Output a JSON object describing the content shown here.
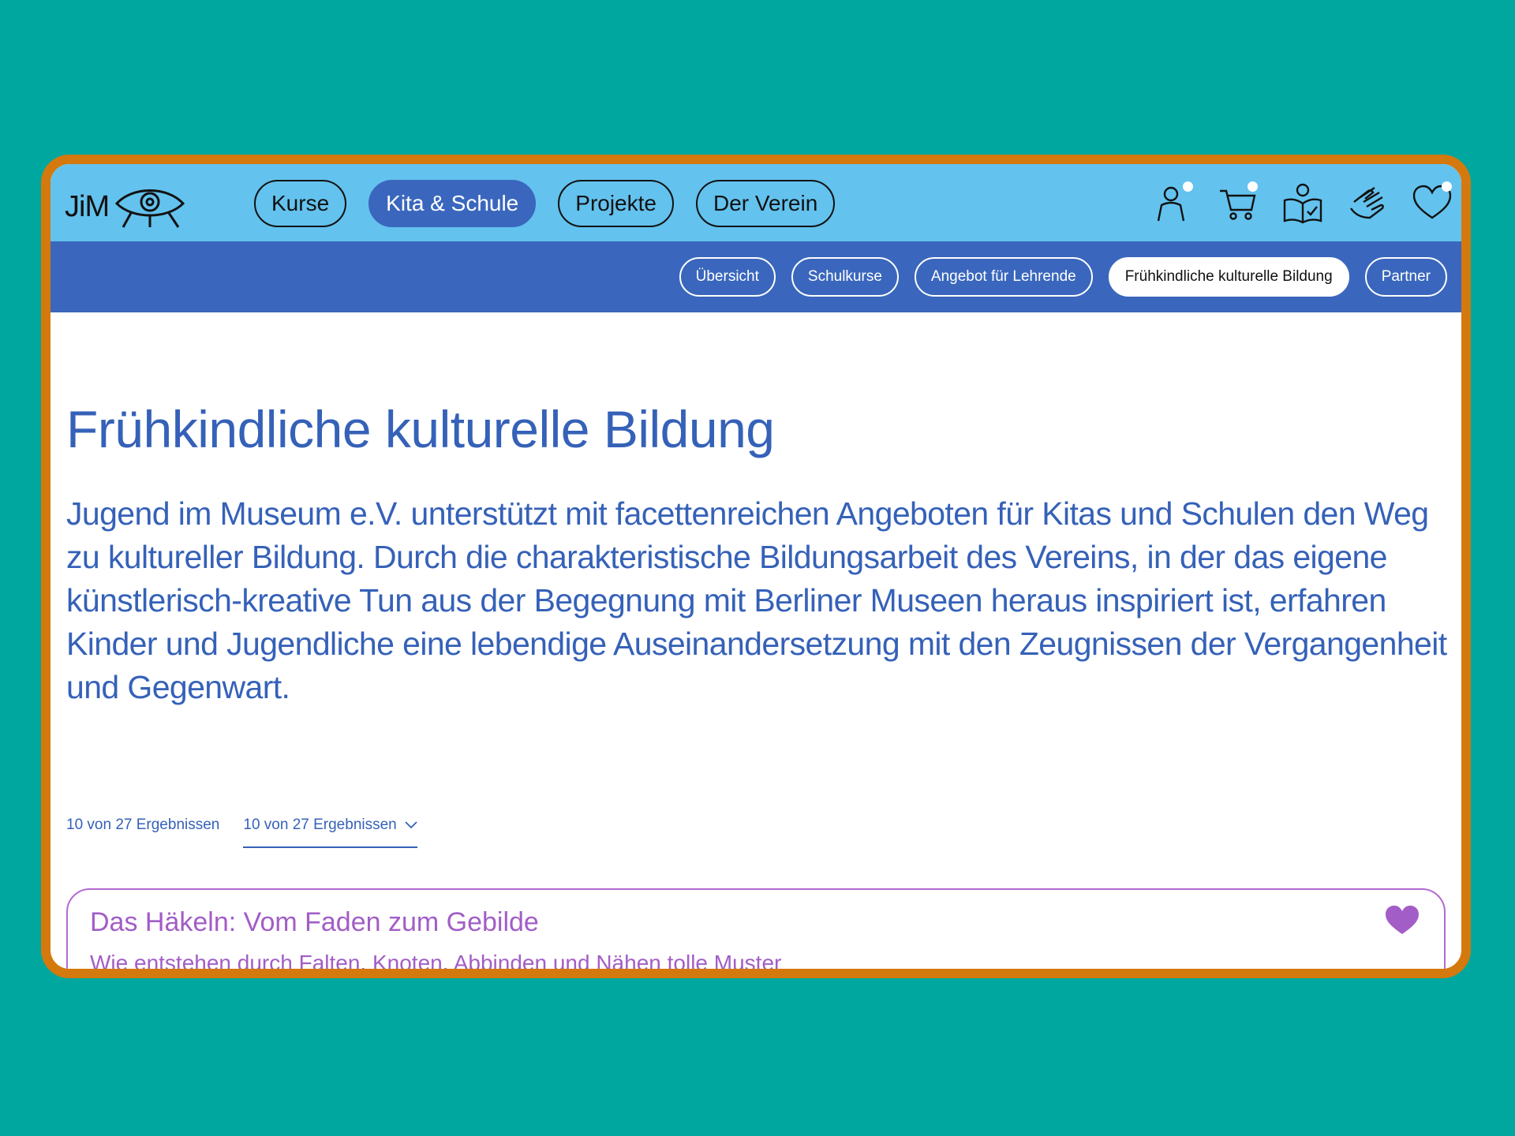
{
  "logo": {
    "text": "JiM"
  },
  "main_nav": [
    {
      "label": "Kurse",
      "active": false
    },
    {
      "label": "Kita & Schule",
      "active": true
    },
    {
      "label": "Projekte",
      "active": false
    },
    {
      "label": "Der Verein",
      "active": false
    }
  ],
  "header_icons": [
    "user-icon",
    "cart-icon",
    "reader-icon",
    "hands-icon",
    "heart-icon"
  ],
  "sub_nav": [
    {
      "label": "Übersicht",
      "active": false
    },
    {
      "label": "Schulkurse",
      "active": false
    },
    {
      "label": "Angebot für Lehrende",
      "active": false
    },
    {
      "label": "Frühkindliche kulturelle Bildung",
      "active": true
    },
    {
      "label": "Partner",
      "active": false
    }
  ],
  "page": {
    "title": "Frühkindliche kulturelle Bildung",
    "intro": "Jugend im Museum e.V. unterstützt mit facettenreichen Angeboten für Kitas und Schulen den Weg zu kultureller Bildung. Durch die charakteristische Bildungsarbeit des Vereins, in der das eigene künstlerisch-kreative Tun aus der Begegnung mit Berliner Museen heraus inspiriert ist, erfahren Kinder und Jugendliche eine lebendige Auseinandersetzung mit den Zeugnissen der Vergangenheit und Gegenwart.",
    "results_count": "10 von 27 Ergebnissen",
    "results_select": "10 von 27 Ergebnissen"
  },
  "card": {
    "title": "Das Häkeln: Vom Faden zum Gebilde",
    "subtitle": "Wie entstehen durch Falten, Knoten, Abbinden und Nähen tolle Muster"
  },
  "colors": {
    "background": "#00a79e",
    "frame": "#d4790e",
    "topbar": "#63c2ee",
    "subbar": "#3a67bd",
    "text_blue": "#3561b8",
    "card_purple": "#a25dc6"
  }
}
